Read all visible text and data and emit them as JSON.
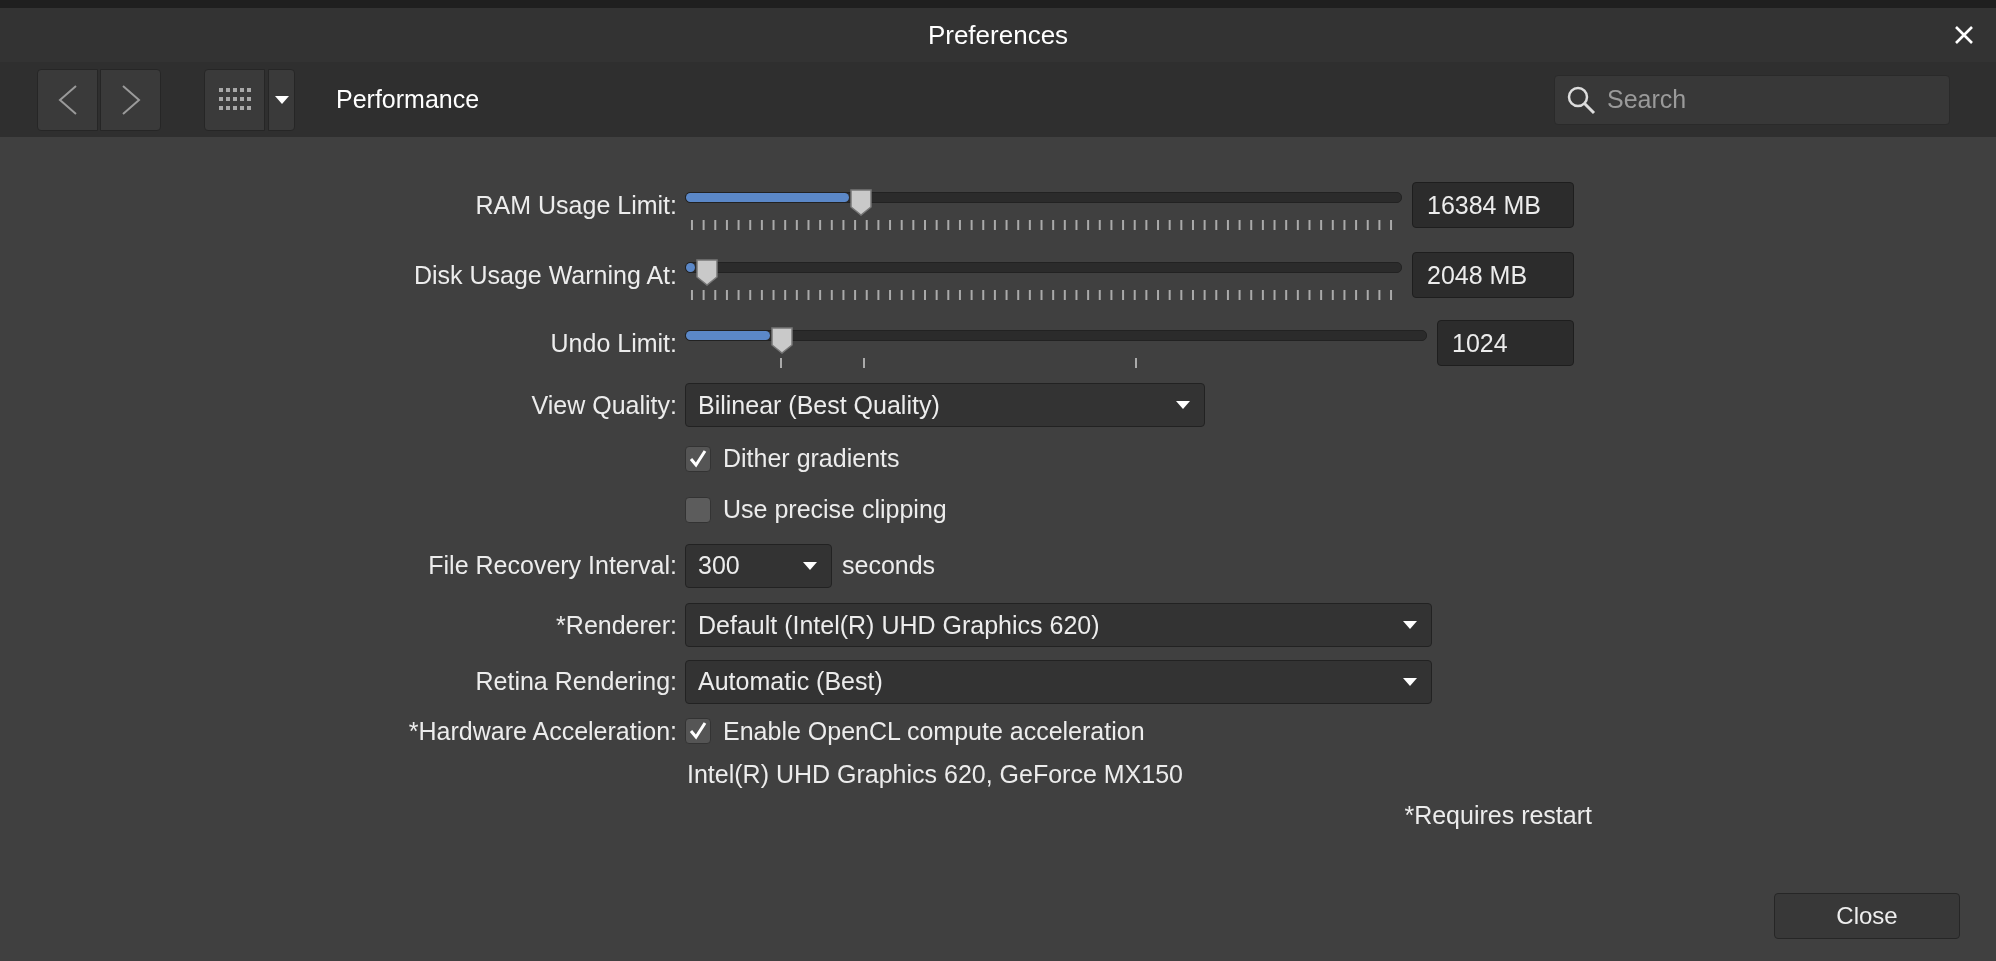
{
  "window": {
    "title": "Preferences"
  },
  "toolbar": {
    "page_title": "Performance",
    "search": {
      "placeholder": "Search"
    }
  },
  "settings": [
    {
      "kind": "slider",
      "label": "RAM Usage Limit:",
      "level": 0.245,
      "value": "16384 MB"
    },
    {
      "kind": "slider",
      "label": "Disk Usage Warning At:",
      "level": 0.03,
      "value": "2048 MB"
    },
    {
      "kind": "stepped-slider",
      "label": "Undo Limit:",
      "level": 0.13,
      "value": "1024"
    },
    {
      "kind": "dropdown",
      "label": "View Quality:",
      "value": "Bilinear (Best Quality)"
    },
    {
      "kind": "checkbox",
      "text": "Dither gradients",
      "checked": true
    },
    {
      "kind": "checkbox",
      "text": "Use precise clipping",
      "checked": false
    },
    {
      "kind": "dropdown",
      "label": "File Recovery Interval:",
      "value": "300",
      "suffix": "seconds"
    },
    {
      "kind": "dropdown",
      "label": "*Renderer:",
      "value": "Default (Intel(R) UHD Graphics 620)"
    },
    {
      "kind": "dropdown",
      "label": "Retina Rendering:",
      "value": "Automatic (Best)"
    },
    {
      "kind": "checkbox",
      "label": "*Hardware Acceleration:",
      "text": "Enable OpenCL compute acceleration",
      "checked": true
    },
    {
      "kind": "note",
      "text": "Intel(R) UHD Graphics 620, GeForce MX150"
    }
  ],
  "footnote": "*Requires restart",
  "buttons": [
    {
      "label": "Close"
    }
  ]
}
